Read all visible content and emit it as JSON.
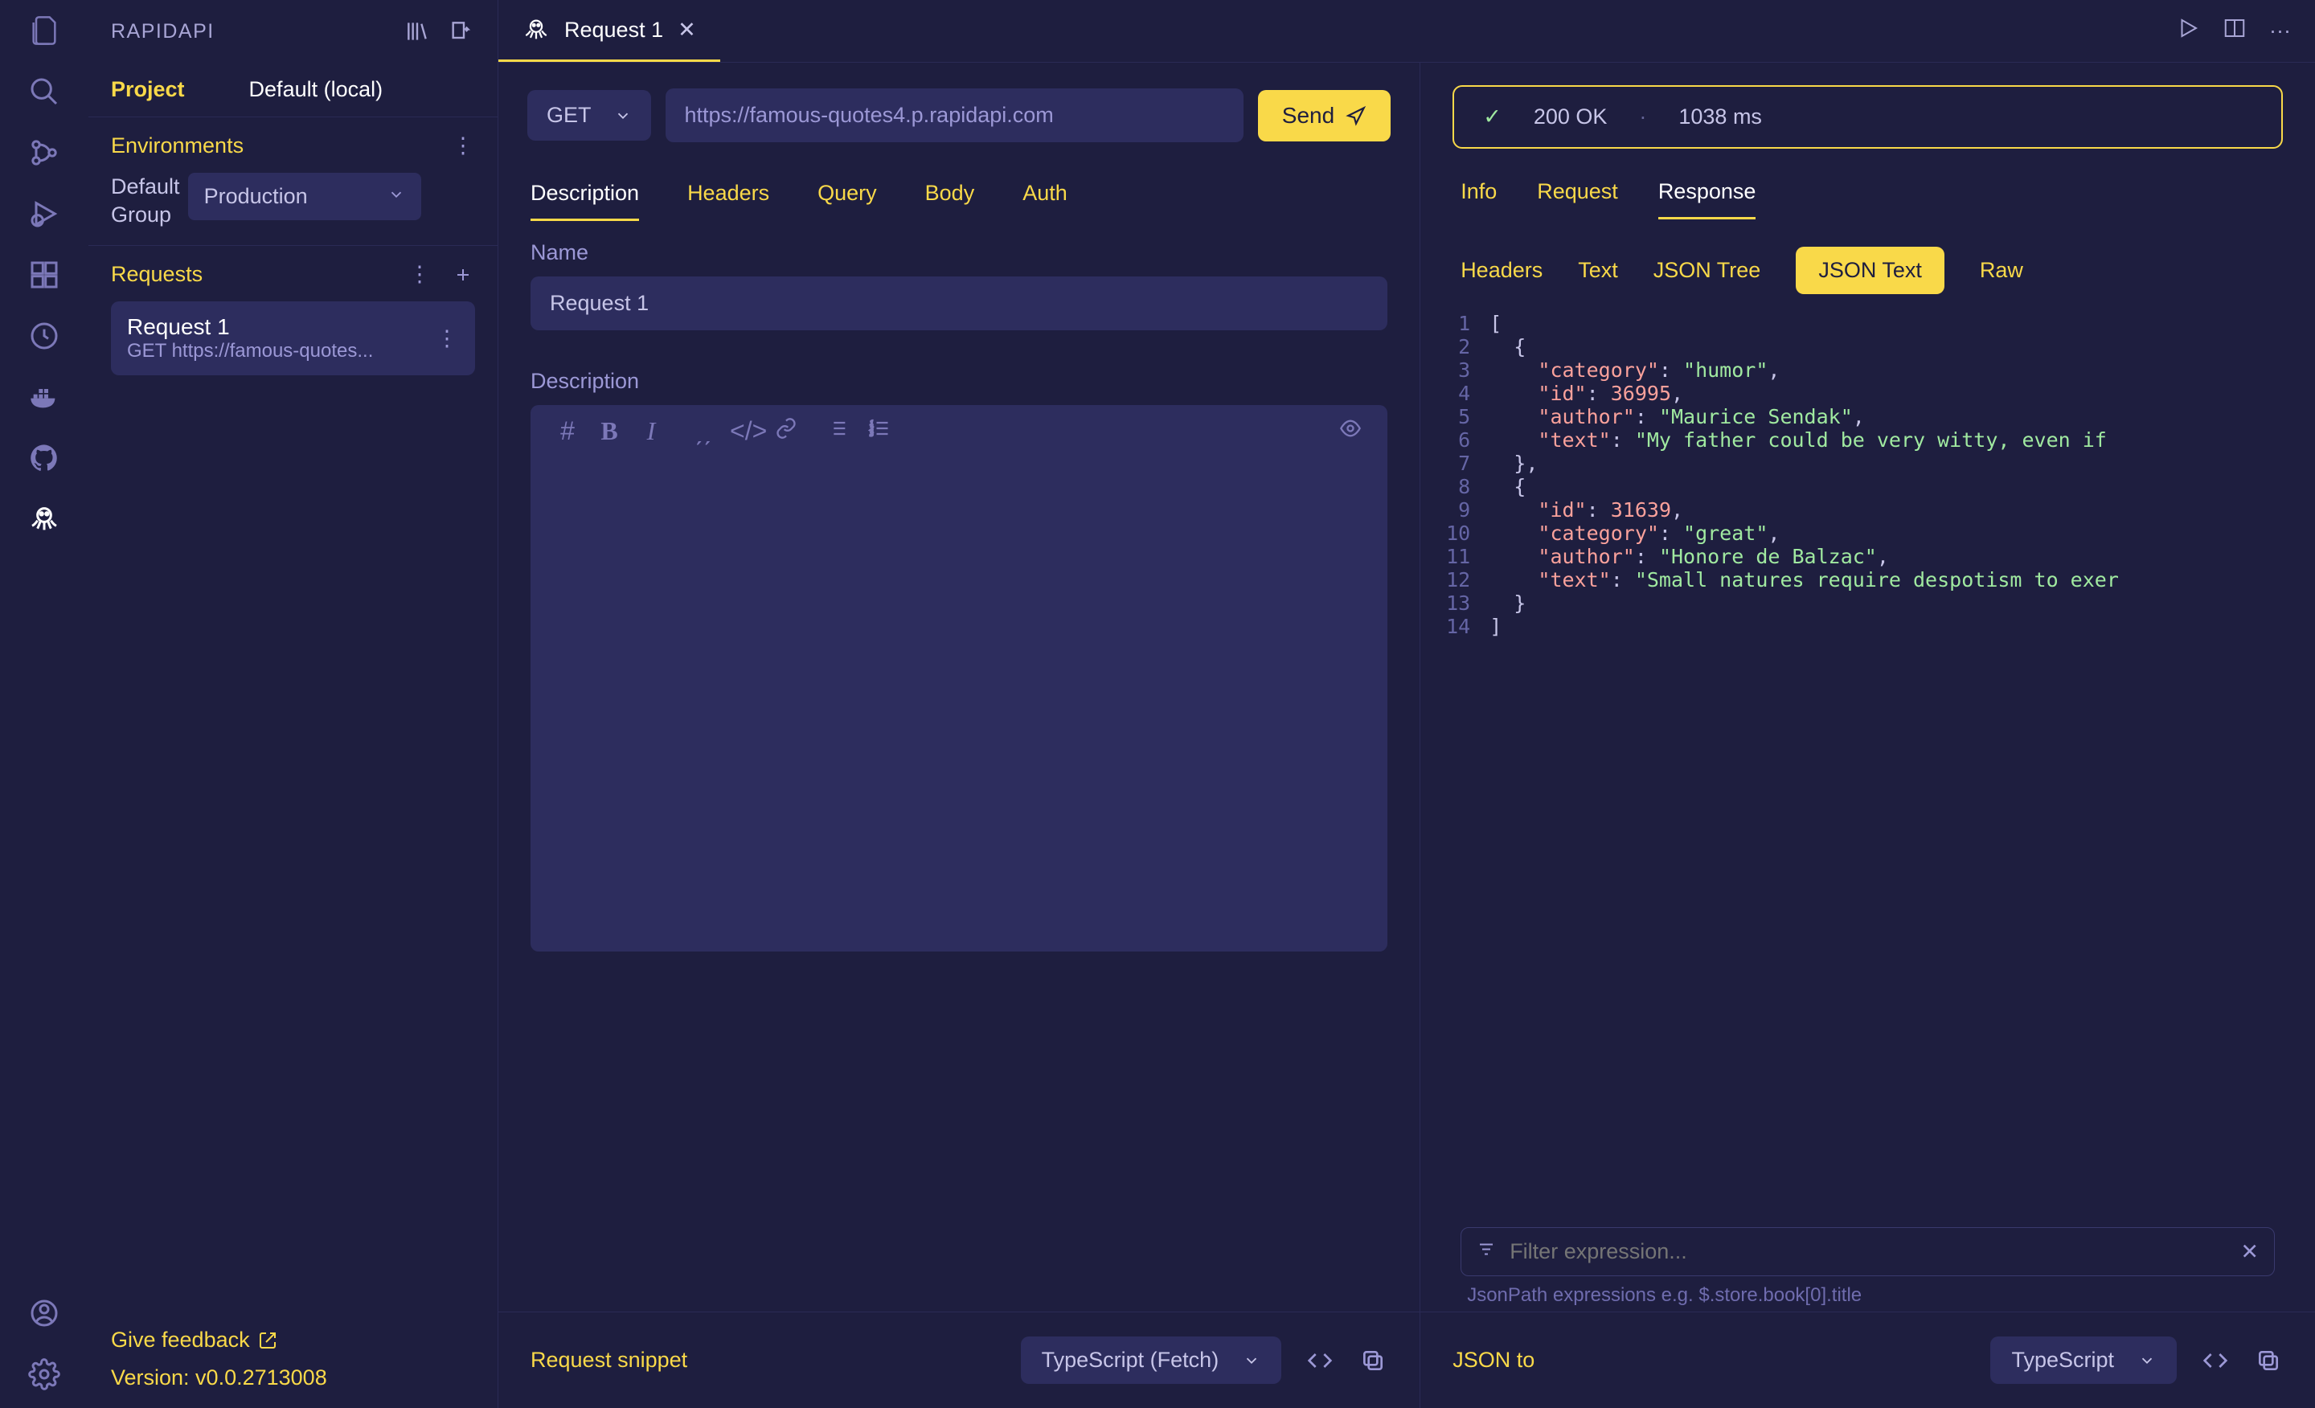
{
  "sidebar": {
    "title": "RAPIDAPI",
    "project_label": "Project",
    "project_value": "Default (local)",
    "environments_label": "Environments",
    "env_group_label": "Default\nGroup",
    "env_selected": "Production",
    "requests_label": "Requests",
    "request_items": [
      {
        "name": "Request 1",
        "sub": "GET https://famous-quotes..."
      }
    ],
    "feedback_label": "Give feedback",
    "version_label": "Version: v0.0.2713008"
  },
  "tab": {
    "title": "Request 1"
  },
  "request": {
    "method": "GET",
    "url": "https://famous-quotes4.p.rapidapi.com",
    "send_label": "Send",
    "tabs": [
      "Description",
      "Headers",
      "Query",
      "Body",
      "Auth"
    ],
    "active_tab": "Description",
    "name_label": "Name",
    "name_value": "Request 1",
    "description_label": "Description",
    "snippet_label": "Request snippet",
    "snippet_lang": "TypeScript (Fetch)"
  },
  "response": {
    "status_text": "200 OK",
    "time_text": "1038 ms",
    "nav": [
      "Info",
      "Request",
      "Response"
    ],
    "active_nav": "Response",
    "subnav": [
      "Headers",
      "Text",
      "JSON Tree",
      "JSON Text",
      "Raw"
    ],
    "active_subnav": "JSON Text",
    "json_lines": [
      [
        {
          "t": "punc",
          "v": "["
        }
      ],
      [
        {
          "t": "punc",
          "v": "  {"
        }
      ],
      [
        {
          "t": "punc",
          "v": "    "
        },
        {
          "t": "key",
          "v": "\"category\""
        },
        {
          "t": "punc",
          "v": ": "
        },
        {
          "t": "str",
          "v": "\"humor\""
        },
        {
          "t": "punc",
          "v": ","
        }
      ],
      [
        {
          "t": "punc",
          "v": "    "
        },
        {
          "t": "key",
          "v": "\"id\""
        },
        {
          "t": "punc",
          "v": ": "
        },
        {
          "t": "num",
          "v": "36995"
        },
        {
          "t": "punc",
          "v": ","
        }
      ],
      [
        {
          "t": "punc",
          "v": "    "
        },
        {
          "t": "key",
          "v": "\"author\""
        },
        {
          "t": "punc",
          "v": ": "
        },
        {
          "t": "str",
          "v": "\"Maurice Sendak\""
        },
        {
          "t": "punc",
          "v": ","
        }
      ],
      [
        {
          "t": "punc",
          "v": "    "
        },
        {
          "t": "key",
          "v": "\"text\""
        },
        {
          "t": "punc",
          "v": ": "
        },
        {
          "t": "str",
          "v": "\"My father could be very witty, even if "
        }
      ],
      [
        {
          "t": "punc",
          "v": "  },"
        }
      ],
      [
        {
          "t": "punc",
          "v": "  {"
        }
      ],
      [
        {
          "t": "punc",
          "v": "    "
        },
        {
          "t": "key",
          "v": "\"id\""
        },
        {
          "t": "punc",
          "v": ": "
        },
        {
          "t": "num",
          "v": "31639"
        },
        {
          "t": "punc",
          "v": ","
        }
      ],
      [
        {
          "t": "punc",
          "v": "    "
        },
        {
          "t": "key",
          "v": "\"category\""
        },
        {
          "t": "punc",
          "v": ": "
        },
        {
          "t": "str",
          "v": "\"great\""
        },
        {
          "t": "punc",
          "v": ","
        }
      ],
      [
        {
          "t": "punc",
          "v": "    "
        },
        {
          "t": "key",
          "v": "\"author\""
        },
        {
          "t": "punc",
          "v": ": "
        },
        {
          "t": "str",
          "v": "\"Honore de Balzac\""
        },
        {
          "t": "punc",
          "v": ","
        }
      ],
      [
        {
          "t": "punc",
          "v": "    "
        },
        {
          "t": "key",
          "v": "\"text\""
        },
        {
          "t": "punc",
          "v": ": "
        },
        {
          "t": "str",
          "v": "\"Small natures require despotism to exer"
        }
      ],
      [
        {
          "t": "punc",
          "v": "  }"
        }
      ],
      [
        {
          "t": "punc",
          "v": "]"
        }
      ]
    ],
    "filter_placeholder": "Filter expression...",
    "filter_hint": "JsonPath expressions e.g. $.store.book[0].title",
    "jsonto_label": "JSON to",
    "jsonto_lang": "TypeScript"
  }
}
